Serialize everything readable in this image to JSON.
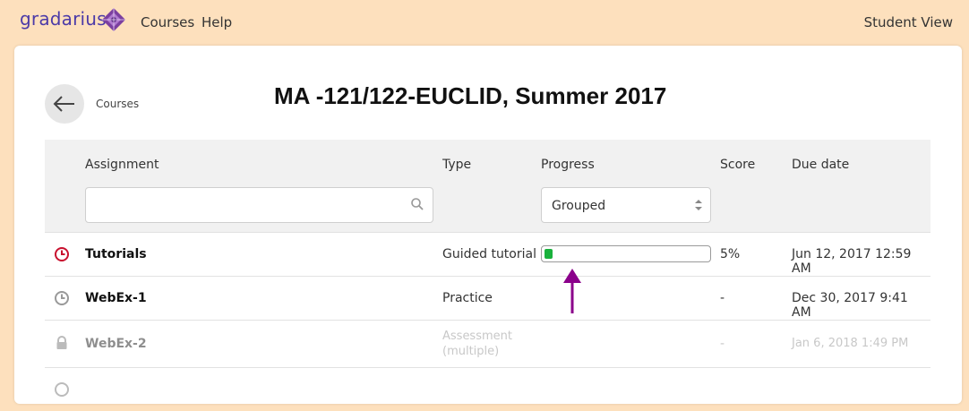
{
  "header": {
    "logo_text": "gradarius",
    "nav": [
      {
        "label": "Courses"
      },
      {
        "label": "Help"
      }
    ],
    "student_view_label": "Student View"
  },
  "page": {
    "back_label": "Courses",
    "title": "MA -121/122-EUCLID, Summer 2017"
  },
  "table": {
    "columns": {
      "assignment": "Assignment",
      "type": "Type",
      "progress": "Progress",
      "score": "Score",
      "due": "Due date"
    },
    "search": {
      "value": "",
      "placeholder": ""
    },
    "progress_filter": {
      "selected": "Grouped"
    },
    "rows": [
      {
        "name": "Tutorials",
        "type": "Guided tutorial",
        "progress_percent": 5,
        "score": "5%",
        "due": "Jun 12, 2017 12:59 AM",
        "status": "overdue"
      },
      {
        "name": "WebEx-1",
        "type": "Practice",
        "score": "-",
        "due": "Dec 30, 2017 9:41 AM",
        "status": "open"
      },
      {
        "name": "WebEx-2",
        "type_line1": "Assessment",
        "type_line2": "(multiple)",
        "score": "-",
        "due": "Jan 6, 2018 1:49 PM",
        "status": "locked"
      }
    ]
  },
  "colors": {
    "background": "#fde0bd",
    "brand": "#4b3aa8",
    "overdue": "#c8102e",
    "progress_fill": "#19b13c",
    "annotation_arrow": "#8b008b"
  }
}
